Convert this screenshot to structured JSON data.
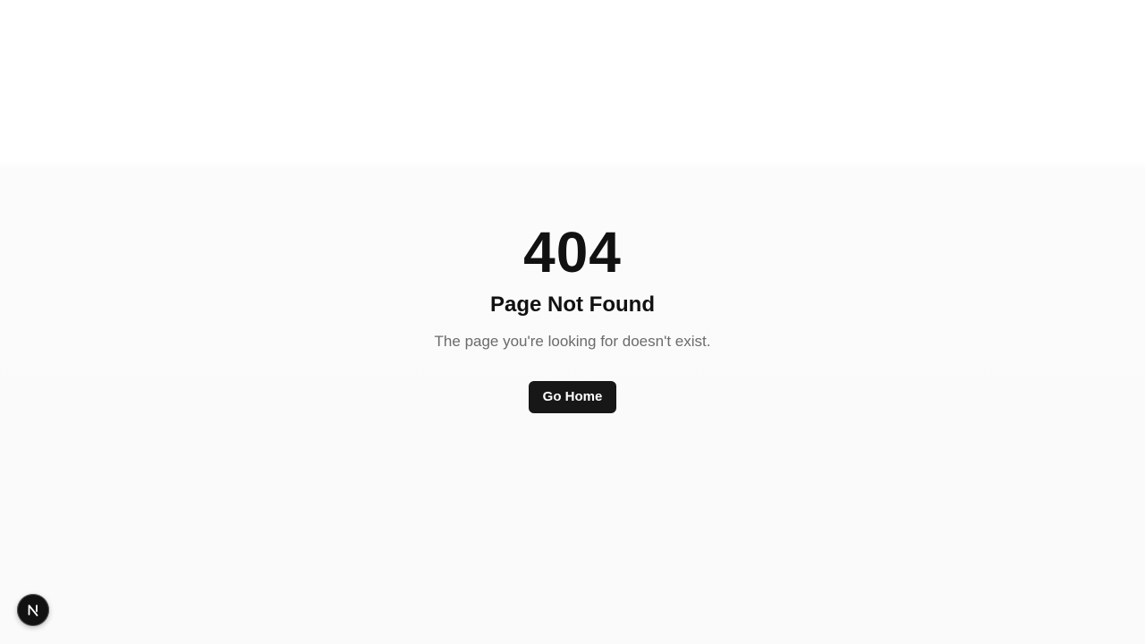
{
  "error": {
    "code": "404",
    "title": "Page Not Found",
    "message": "The page you're looking for doesn't exist."
  },
  "actions": {
    "home_button_label": "Go Home"
  },
  "dev_indicator": {
    "icon": "nextjs-logo-icon"
  }
}
